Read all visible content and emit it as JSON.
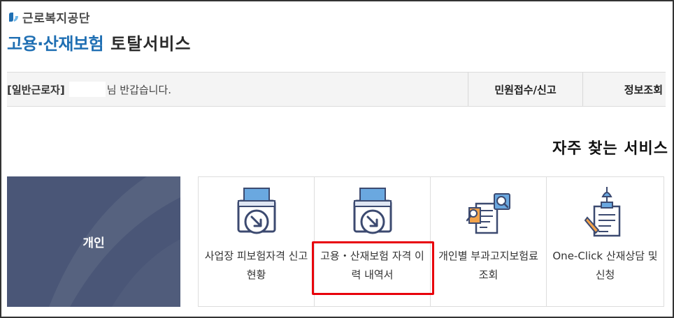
{
  "header": {
    "org_name": "근로복지공단",
    "title_part1": "고용·산재보험",
    "title_part2": "토탈서비스"
  },
  "colors": {
    "brand_blue": "#1f6fb3",
    "category_bg": "#4a5677",
    "highlight_red": "#e8000b"
  },
  "navbar": {
    "user_type": "[일반근로자]",
    "greeting_suffix": "님 반갑습니다.",
    "menu": [
      {
        "label": "민원접수/신고"
      },
      {
        "label": "정보조회"
      }
    ]
  },
  "section": {
    "title": "자주 찾는 서비스"
  },
  "category": {
    "label": "개인"
  },
  "services": [
    {
      "label": "사업장 피보험자격 신고현황",
      "icon": "document-download-icon"
    },
    {
      "label": "고용・산재보험 자격 이력 내역서",
      "icon": "document-download-icon"
    },
    {
      "label": "개인별 부과고지보험료 조회",
      "icon": "document-search-icon"
    },
    {
      "label": "One-Click 산재상담 및 신청",
      "icon": "document-pen-icon"
    }
  ]
}
